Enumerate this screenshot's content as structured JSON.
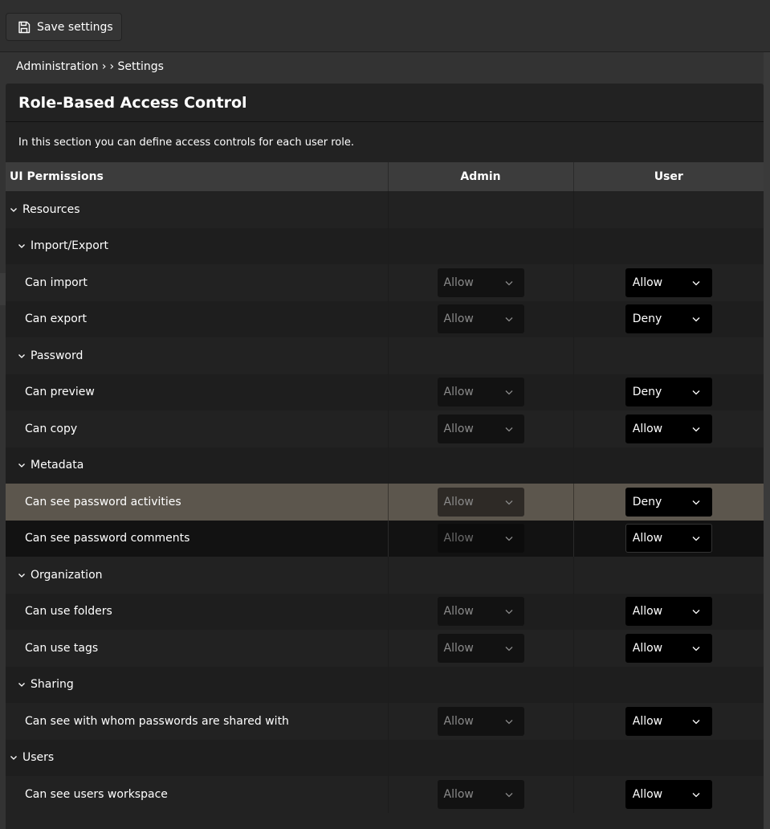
{
  "toolbar": {
    "save_label": "Save settings",
    "save_icon": "floppy-disk-icon"
  },
  "breadcrumb": {
    "items": [
      "Administration ›",
      "› Settings"
    ]
  },
  "panel": {
    "title": "Role-Based Access Control",
    "description": "In this section you can define access controls for each user role."
  },
  "table": {
    "headers": [
      "UI Permissions",
      "Admin",
      "User"
    ],
    "rows": [
      {
        "type": "group",
        "level": 0,
        "label": "Resources"
      },
      {
        "type": "group",
        "level": 1,
        "label": "Import/Export"
      },
      {
        "type": "perm",
        "label": "Can import",
        "admin": "Allow",
        "user": "Allow"
      },
      {
        "type": "perm",
        "label": "Can export",
        "admin": "Allow",
        "user": "Deny"
      },
      {
        "type": "group",
        "level": 1,
        "label": "Password"
      },
      {
        "type": "perm",
        "label": "Can preview",
        "admin": "Allow",
        "user": "Deny"
      },
      {
        "type": "perm",
        "label": "Can copy",
        "admin": "Allow",
        "user": "Allow"
      },
      {
        "type": "group",
        "level": 1,
        "label": "Metadata"
      },
      {
        "type": "perm",
        "label": "Can see password activities",
        "admin": "Allow",
        "user": "Deny",
        "state": "hover"
      },
      {
        "type": "perm",
        "label": "Can see password comments",
        "admin": "Allow",
        "user": "Allow",
        "state": "focused"
      },
      {
        "type": "group",
        "level": 1,
        "label": "Organization"
      },
      {
        "type": "perm",
        "label": "Can use folders",
        "admin": "Allow",
        "user": "Allow"
      },
      {
        "type": "perm",
        "label": "Can use tags",
        "admin": "Allow",
        "user": "Allow"
      },
      {
        "type": "group",
        "level": 1,
        "label": "Sharing"
      },
      {
        "type": "perm",
        "label": "Can see with whom passwords are shared with",
        "admin": "Allow",
        "user": "Allow"
      },
      {
        "type": "group",
        "level": 0,
        "label": "Users"
      },
      {
        "type": "perm",
        "label": "Can see users workspace",
        "admin": "Allow",
        "user": "Allow"
      }
    ]
  }
}
